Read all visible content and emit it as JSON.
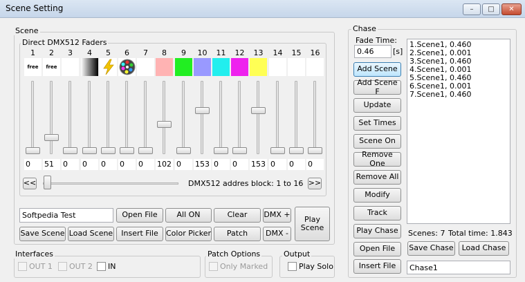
{
  "window": {
    "title": "Scene Setting",
    "minimize": "–",
    "maximize": "□",
    "close": "✕"
  },
  "scene": {
    "group_label": "Scene",
    "faders_label": "Direct DMX512 Faders",
    "channels": [
      {
        "num": "1",
        "swatch": "free",
        "color": "#ffffff",
        "value": "0"
      },
      {
        "num": "2",
        "swatch": "free",
        "color": "#ffffff",
        "value": "51"
      },
      {
        "num": "3",
        "swatch": "",
        "color": "#ffffff",
        "value": "0"
      },
      {
        "num": "4",
        "swatch": "",
        "color": "gradient-gray",
        "value": "0"
      },
      {
        "num": "5",
        "swatch": "",
        "color": "lightning-icon",
        "value": "0"
      },
      {
        "num": "6",
        "swatch": "",
        "color": "gobo-wheel-icon",
        "value": "0"
      },
      {
        "num": "7",
        "swatch": "",
        "color": "#ffffff",
        "value": "0"
      },
      {
        "num": "8",
        "swatch": "",
        "color": "#ffb3b3",
        "value": "102"
      },
      {
        "num": "9",
        "swatch": "",
        "color": "#22ee22",
        "value": "0"
      },
      {
        "num": "10",
        "swatch": "",
        "color": "#9999ff",
        "value": "153"
      },
      {
        "num": "11",
        "swatch": "",
        "color": "#22eeee",
        "value": "0"
      },
      {
        "num": "12",
        "swatch": "",
        "color": "#ee22ee",
        "value": "0"
      },
      {
        "num": "13",
        "swatch": "",
        "color": "#ffff55",
        "value": "153"
      },
      {
        "num": "14",
        "swatch": "",
        "color": "#ffffff",
        "value": "0"
      },
      {
        "num": "15",
        "swatch": "",
        "color": "#ffffff",
        "value": "0"
      },
      {
        "num": "16",
        "swatch": "",
        "color": "#ffffff",
        "value": "0"
      }
    ],
    "prev_btn": "<<",
    "next_btn": ">>",
    "block_label": "DMX512 addres block: 1 to 16",
    "name_value": "Softpedia Test",
    "buttons": {
      "open_file": "Open File",
      "all_on": "All ON",
      "clear": "Clear",
      "dmx_plus": "DMX +",
      "play_scene": "Play Scene",
      "save_scene": "Save Scene",
      "load_scene": "Load Scene",
      "insert_file": "Insert File",
      "color_picker": "Color Picker",
      "patch": "Patch",
      "dmx_minus": "DMX -"
    }
  },
  "interfaces": {
    "label": "Interfaces",
    "out1": "OUT 1",
    "out2": "OUT 2",
    "in": "IN"
  },
  "patch_options": {
    "label": "Patch Options",
    "only_marked": "Only Marked"
  },
  "output": {
    "label": "Output",
    "play_solo": "Play Solo"
  },
  "chase": {
    "group_label": "Chase",
    "fade_label": "Fade Time:",
    "fade_value": "0.46",
    "fade_unit": "[s]",
    "buttons": [
      "Add Scene",
      "Add Scene F",
      "Update",
      "Set Times",
      "Scene On",
      "Remove One",
      "Remove All",
      "Modify",
      "Track",
      "Play Chase",
      "Open File"
    ],
    "insert_file": "Insert File",
    "save_chase": "Save Chase",
    "load_chase": "Load Chase",
    "items": [
      "1.Scene1, 0.460",
      "2.Scene1, 0.001",
      "3.Scene1, 0.460",
      "4.Scene1, 0.001",
      "5.Scene1, 0.460",
      "6.Scene1, 0.001",
      "7.Scene1, 0.460"
    ],
    "scenes_count": "Scenes: 7",
    "total_time": "Total time: 1.843",
    "name_value": "Chase1"
  }
}
